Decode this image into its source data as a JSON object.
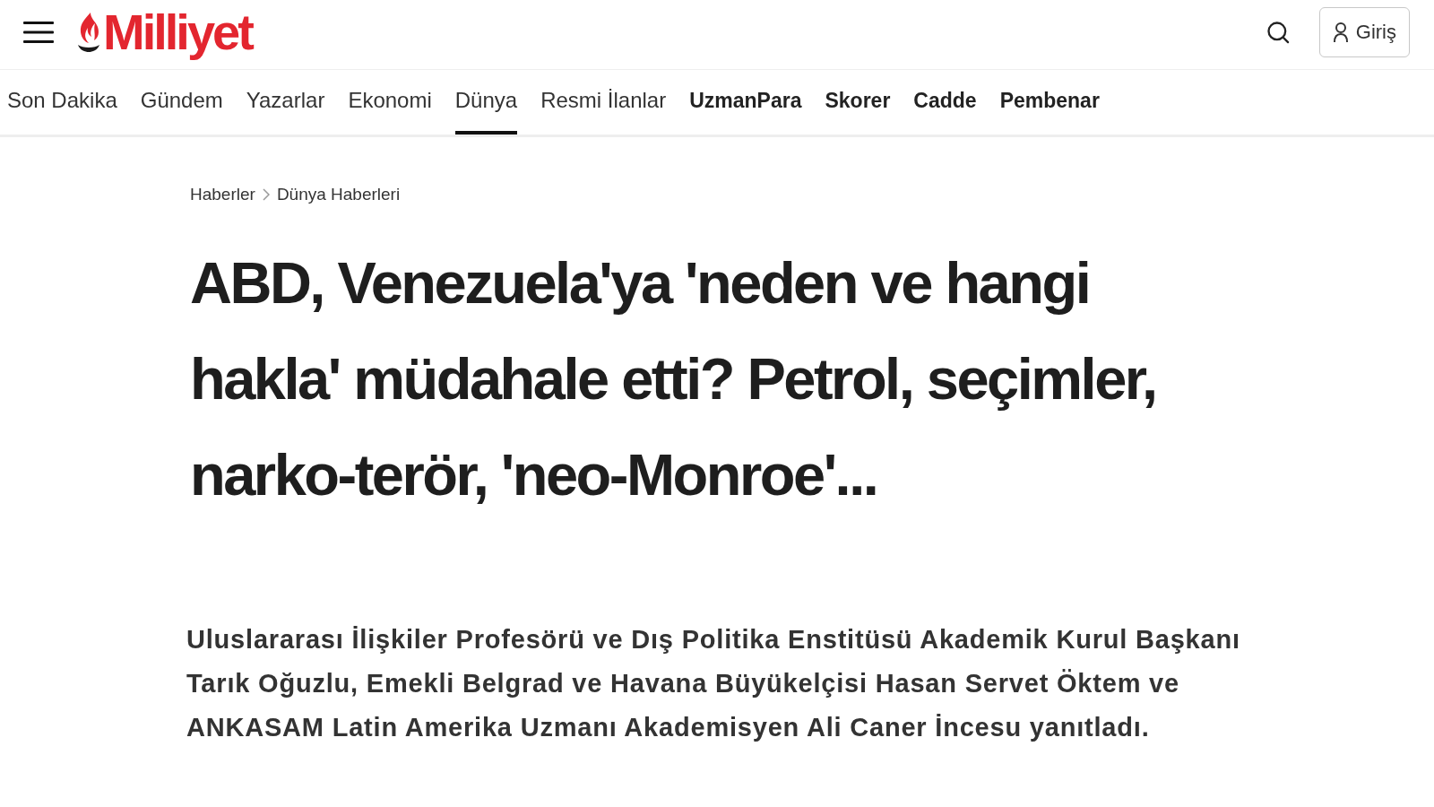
{
  "header": {
    "logo": "Milliyet",
    "login_button": "Giriş"
  },
  "nav": {
    "items": [
      {
        "label": "Son Dakika",
        "kind": "section",
        "selected": false
      },
      {
        "label": "Gündem",
        "kind": "section",
        "selected": false
      },
      {
        "label": "Yazarlar",
        "kind": "section",
        "selected": false
      },
      {
        "label": "Ekonomi",
        "kind": "section",
        "selected": false
      },
      {
        "label": "Dünya",
        "kind": "section",
        "selected": true
      },
      {
        "label": "Resmi İlanlar",
        "kind": "section",
        "selected": false
      },
      {
        "label": "UzmanPara",
        "kind": "partner",
        "selected": false
      },
      {
        "label": "Skorer",
        "kind": "partner",
        "selected": false
      },
      {
        "label": "Cadde",
        "kind": "partner",
        "selected": false
      },
      {
        "label": "Pembenar",
        "kind": "partner",
        "selected": false
      }
    ]
  },
  "breadcrumb": [
    "Haberler",
    "Dünya Haberleri"
  ],
  "article": {
    "headline": "ABD, Venezuela'ya 'neden ve hangi hakla' müdahale etti? Petrol, seçimler, narko-terör, 'neo-Monroe'...",
    "summary": "Uluslararası İlişkiler Profesörü ve Dış Politika Enstitüsü Akademik Kurul Başkanı Tarık Oğuzlu, Emekli Belgrad ve Havana Büyükelçisi Hasan Servet Öktem ve ANKASAM Latin Amerika Uzmanı Akademisyen Ali Caner İncesu yanıtladı."
  }
}
